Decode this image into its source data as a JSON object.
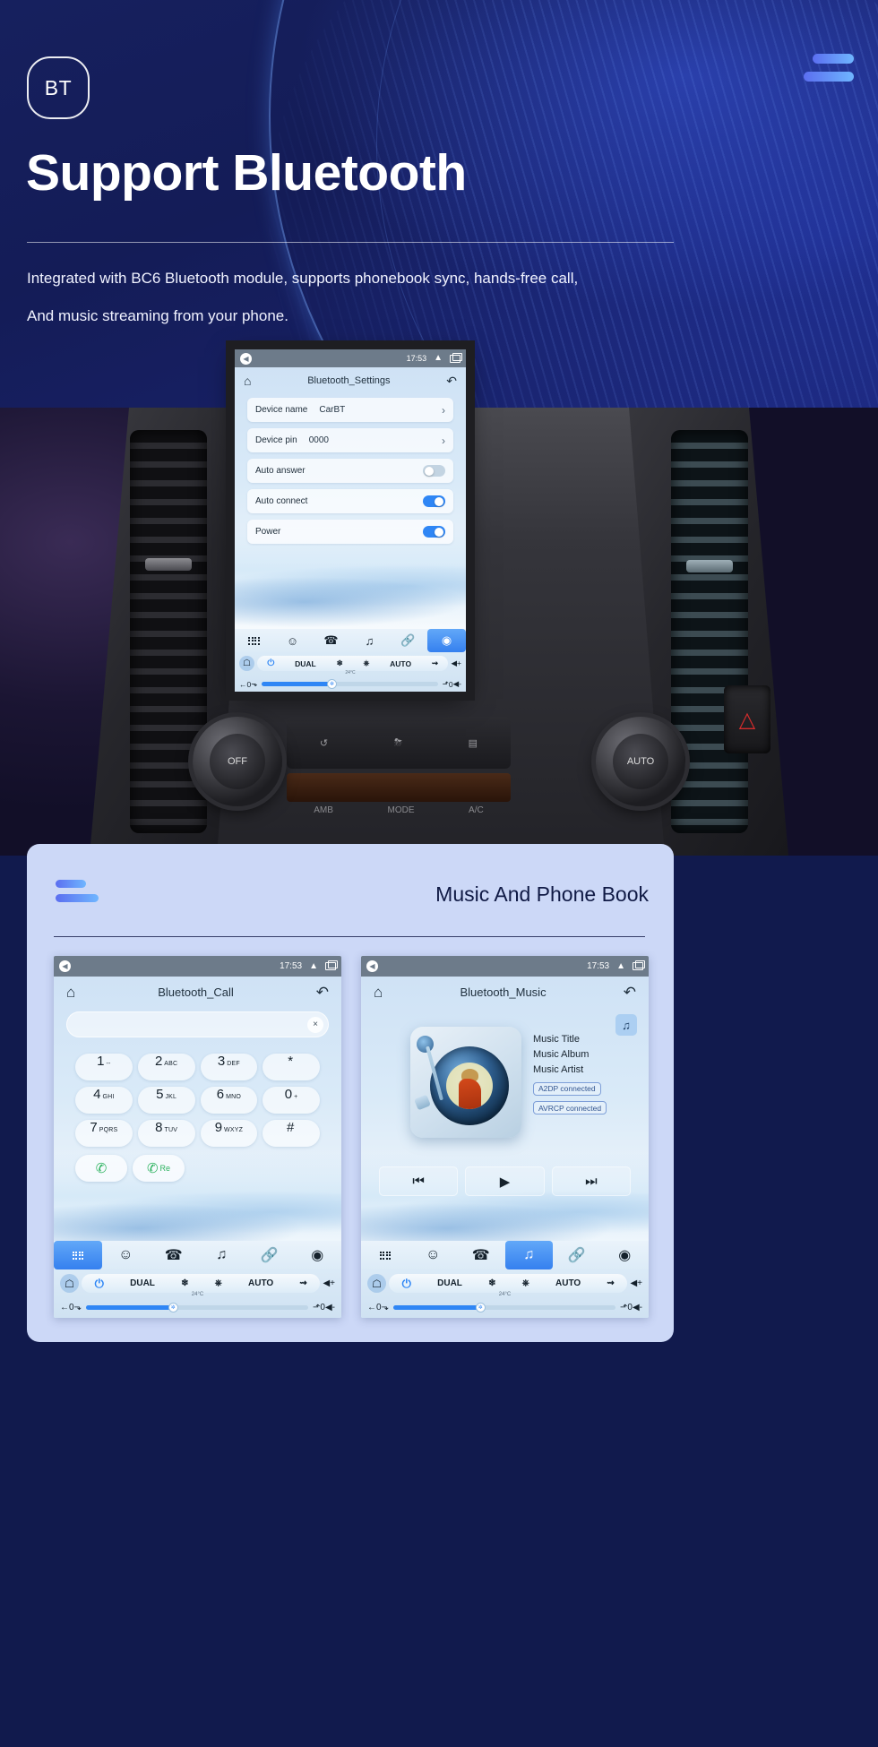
{
  "hero": {
    "badge": "BT",
    "title": "Support Bluetooth",
    "subtitle_line1": "Integrated with BC6 Bluetooth module, supports phonebook sync, hands-free call,",
    "subtitle_line2": "And music streaming from your phone."
  },
  "main_screen": {
    "status": {
      "time": "17:53"
    },
    "nav": {
      "home_icon": "home-icon",
      "title": "Bluetooth_Settings",
      "back_icon": "undo-icon"
    },
    "rows": [
      {
        "label": "Device name",
        "value": "CarBT",
        "type": "chevron"
      },
      {
        "label": "Device pin",
        "value": "0000",
        "type": "chevron"
      },
      {
        "label": "Auto answer",
        "value": "",
        "type": "toggle",
        "on": false
      },
      {
        "label": "Auto connect",
        "value": "",
        "type": "toggle",
        "on": true
      },
      {
        "label": "Power",
        "value": "",
        "type": "toggle",
        "on": true
      }
    ],
    "appbar": [
      {
        "name": "apps-icon",
        "glyph": "apps",
        "active": false
      },
      {
        "name": "contacts-icon",
        "glyph": "♁",
        "active": false
      },
      {
        "name": "phone-icon",
        "glyph": "✆",
        "active": false
      },
      {
        "name": "music-icon",
        "glyph": "♫",
        "active": false
      },
      {
        "name": "link-icon",
        "glyph": "℀",
        "active": false
      },
      {
        "name": "settings-icon",
        "glyph": "⬡",
        "active": true
      }
    ],
    "climate": {
      "dual": "DUAL",
      "snow": "❄",
      "defrost": "⟲",
      "auto": "AUTO",
      "airflow": "↪",
      "vol_up": "◀+",
      "vol_down": "◀-",
      "temp": "24°C",
      "left_value": "0",
      "right_value": "0",
      "home": "⌂",
      "back": "←",
      "seat": "⬎",
      "seat_heat": "⬏"
    }
  },
  "card": {
    "title": "Music And Phone Book"
  },
  "call_screen": {
    "status": {
      "time": "17:53"
    },
    "nav": {
      "title": "Bluetooth_Call"
    },
    "search_value": "",
    "clear_icon": "×",
    "keys": [
      {
        "num": "1",
        "sub": "--"
      },
      {
        "num": "2",
        "sub": "ABC"
      },
      {
        "num": "3",
        "sub": "DEF"
      },
      {
        "num": "*",
        "sub": ""
      },
      {
        "num": "4",
        "sub": "GHI"
      },
      {
        "num": "5",
        "sub": "JKL"
      },
      {
        "num": "6",
        "sub": "MNO"
      },
      {
        "num": "0",
        "sub": "+"
      },
      {
        "num": "7",
        "sub": "PQRS"
      },
      {
        "num": "8",
        "sub": "TUV"
      },
      {
        "num": "9",
        "sub": "WXYZ"
      },
      {
        "num": "#",
        "sub": ""
      }
    ],
    "call_button": "✆",
    "redial_label": "Re",
    "appbar_active_index": 0
  },
  "music_screen": {
    "status": {
      "time": "17:53"
    },
    "nav": {
      "title": "Bluetooth_Music"
    },
    "note_button": "♫",
    "meta": {
      "title": "Music Title",
      "album": "Music Album",
      "artist": "Music Artist",
      "chip_a2dp": "A2DP  connected",
      "chip_avrcp": "AVRCP connected"
    },
    "controls": {
      "prev": "⏮",
      "play": "▶",
      "next": "⏭"
    },
    "appbar_active_index": 3
  },
  "colors": {
    "hero_bg": "#16205e",
    "accent_blue": "#2f86f5",
    "card_bg": "#ccd8f7",
    "title_dark": "#101a45",
    "green_call": "#2cb25f"
  }
}
